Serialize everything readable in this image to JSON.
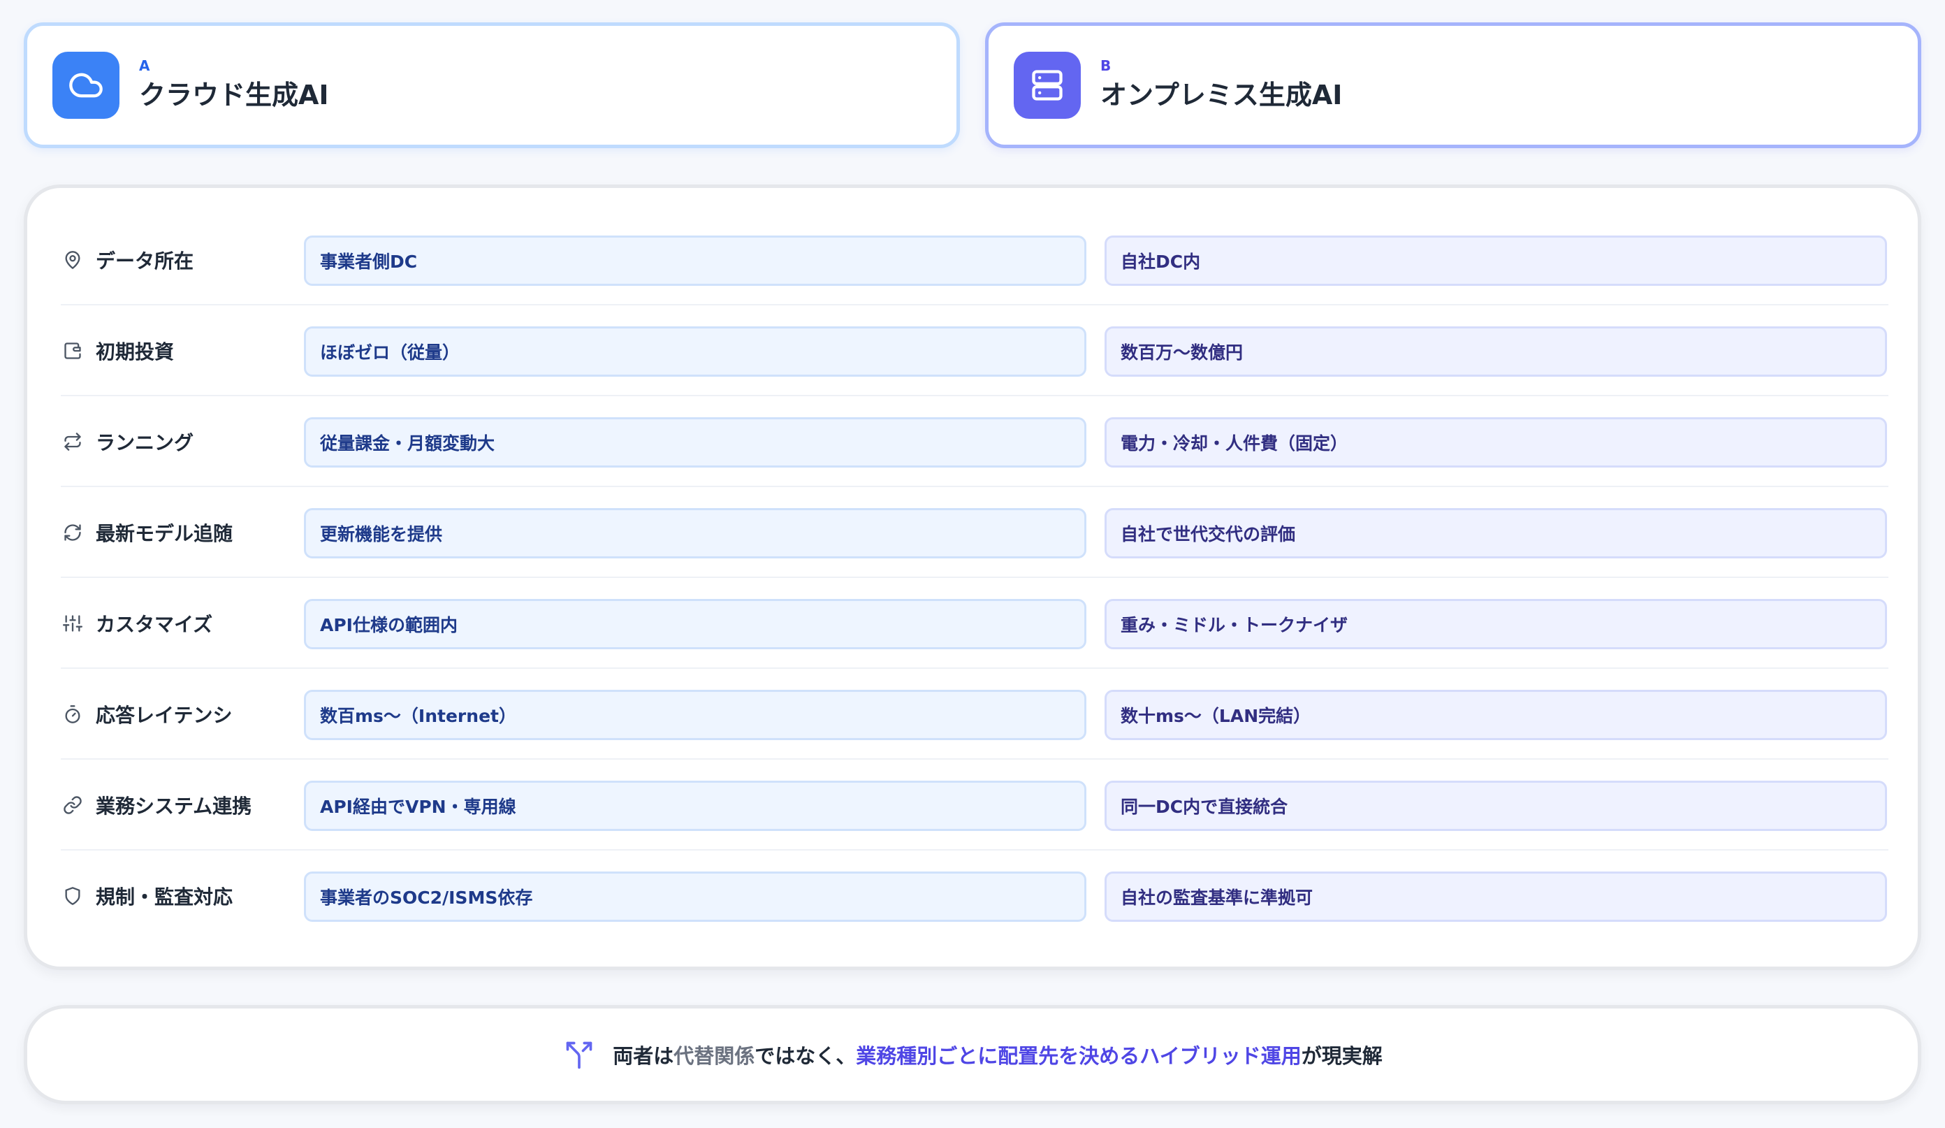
{
  "header": {
    "cloud": {
      "letter": "A",
      "title": "クラウド生成AI",
      "icon": "cloud-icon",
      "color": "#3b82f6"
    },
    "onprem": {
      "letter": "B",
      "title": "オンプレミス生成AI",
      "icon": "server-icon",
      "color": "#6366f1"
    }
  },
  "rows": [
    {
      "label": "データ所在",
      "icon": "map-pin-icon",
      "cloud": "事業者側DC",
      "onprem": "自社DC内"
    },
    {
      "label": "初期投資",
      "icon": "wallet-icon",
      "cloud": "ほぼゼロ（従量）",
      "onprem": "数百万〜数億円"
    },
    {
      "label": "ランニング",
      "icon": "repeat-icon",
      "cloud": "従量課金・月額変動大",
      "onprem": "電力・冷却・人件費（固定）"
    },
    {
      "label": "最新モデル追随",
      "icon": "refresh-icon",
      "cloud": "更新機能を提供",
      "onprem": "自社で世代交代の評価"
    },
    {
      "label": "カスタマイズ",
      "icon": "sliders-icon",
      "cloud": "API仕様の範囲内",
      "onprem": "重み・ミドル・トークナイザ"
    },
    {
      "label": "応答レイテンシ",
      "icon": "timer-icon",
      "cloud": "数百ms〜（Internet）",
      "onprem": "数十ms〜（LAN完結）"
    },
    {
      "label": "業務システム連携",
      "icon": "link-icon",
      "cloud": "API経由でVPN・専用線",
      "onprem": "同一DC内で直接統合"
    },
    {
      "label": "規制・監査対応",
      "icon": "shield-icon",
      "cloud": "事業者のSOC2/ISMS依存",
      "onprem": "自社の監査基準に準拠可"
    }
  ],
  "banner": {
    "icon": "split-arrows-icon",
    "part1": "両者は",
    "part2": "代替関係",
    "part3": "ではなく、",
    "part4": "業務種別ごとに配置先を決めるハイブリッド運用",
    "part5": "が現実解"
  }
}
